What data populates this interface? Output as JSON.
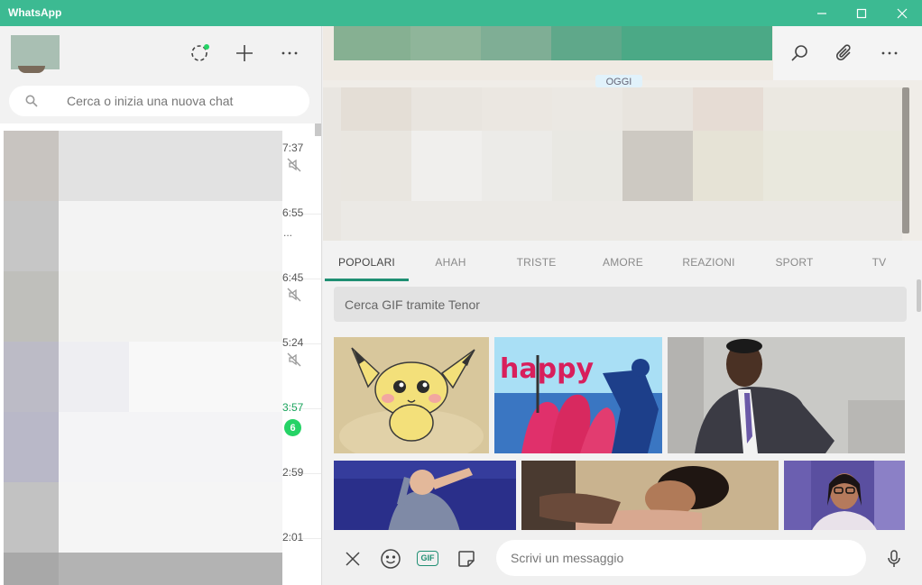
{
  "window": {
    "title": "WhatsApp",
    "controls": [
      "minimize",
      "maximize",
      "close"
    ]
  },
  "left_header": {
    "icons": [
      "status-icon",
      "new-chat-icon",
      "more-options-icon"
    ]
  },
  "search": {
    "placeholder": "Cerca o inizia una nuova chat"
  },
  "chats": [
    {
      "time": "7:37",
      "muted": true,
      "unread": null,
      "preview": ""
    },
    {
      "time": "6:55",
      "muted": false,
      "unread": null,
      "preview": "..."
    },
    {
      "time": "6:45",
      "muted": true,
      "unread": null,
      "preview": ""
    },
    {
      "time": "5:24",
      "muted": true,
      "unread": null,
      "preview": ""
    },
    {
      "time": "3:57",
      "muted": false,
      "unread": "6",
      "preview": ""
    },
    {
      "time": "2:59",
      "muted": false,
      "unread": null,
      "preview": ""
    },
    {
      "time": "2:01",
      "muted": false,
      "unread": null,
      "preview": ""
    }
  ],
  "conversation": {
    "date_chip": "OGGI",
    "header_icons": [
      "search-icon",
      "attach-icon",
      "more-options-icon"
    ]
  },
  "gif_picker": {
    "tabs": [
      "POPOLARI",
      "AHAH",
      "TRISTE",
      "AMORE",
      "REAZIONI",
      "SPORT",
      "TV"
    ],
    "active_tab": "POPOLARI",
    "search_placeholder": "Cerca GIF tramite Tenor",
    "gif_captions": [
      "happy"
    ]
  },
  "composer": {
    "placeholder": "Scrivi un messaggio",
    "gif_label": "GIF"
  },
  "colors": {
    "title_bar": "#3cba92",
    "accent": "#1f8f73",
    "unread_badge": "#25d366"
  }
}
